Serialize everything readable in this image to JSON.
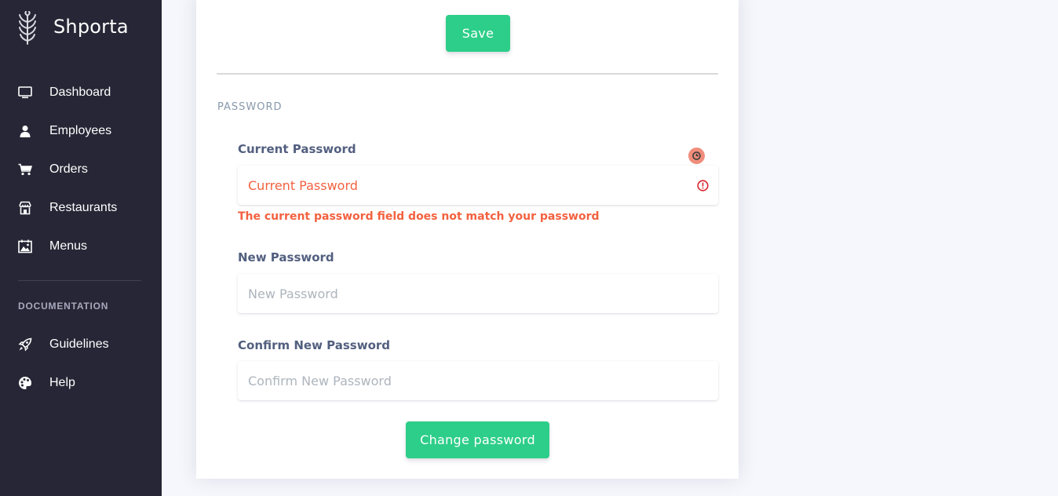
{
  "sidebar": {
    "brand": "Shporta",
    "nav": [
      {
        "label": "Dashboard",
        "icon": "monitor-icon"
      },
      {
        "label": "Employees",
        "icon": "user-icon"
      },
      {
        "label": "Orders",
        "icon": "cart-icon"
      },
      {
        "label": "Restaurants",
        "icon": "shop-icon"
      },
      {
        "label": "Menus",
        "icon": "image-icon"
      }
    ],
    "documentation_title": "DOCUMENTATION",
    "doc_nav": [
      {
        "label": "Guidelines",
        "icon": "spaceship-icon"
      },
      {
        "label": "Help",
        "icon": "palette-icon"
      }
    ]
  },
  "profile": {
    "save_label": "Save",
    "password_section_title": "PASSWORD",
    "current_password": {
      "label": "Current Password",
      "placeholder": "Current Password",
      "error": "The current password field does not match your password"
    },
    "new_password": {
      "label": "New Password",
      "placeholder": "New Password"
    },
    "confirm_password": {
      "label": "Confirm New Password",
      "placeholder": "Confirm New Password"
    },
    "change_password_label": "Change password"
  },
  "colors": {
    "sidebar_bg": "#272636",
    "accent_green": "#2dce89",
    "error": "#f2613f",
    "page_bg": "#f6f7fc"
  }
}
